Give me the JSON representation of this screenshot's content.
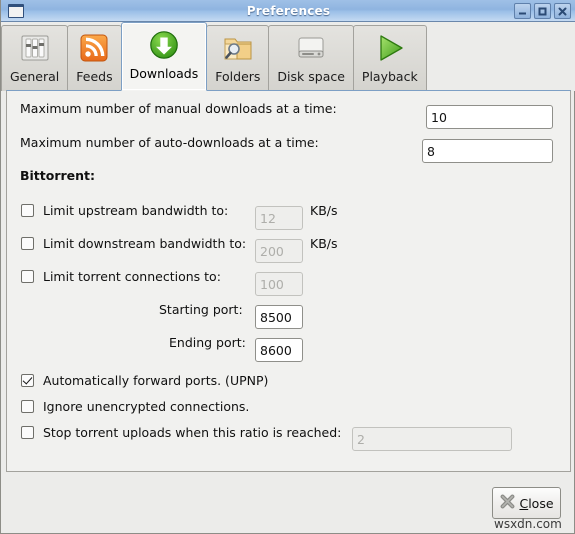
{
  "window": {
    "title": "Preferences",
    "icon": "window-icon",
    "buttons": [
      {
        "name": "minimize-button",
        "glyph": "minimize-icon"
      },
      {
        "name": "maximize-button",
        "glyph": "maximize-icon"
      },
      {
        "name": "close-window-button",
        "glyph": "close-icon"
      }
    ]
  },
  "tabs": [
    {
      "label": "General",
      "icon": "sliders-icon",
      "active": false
    },
    {
      "label": "Feeds",
      "icon": "rss-feed-icon",
      "active": false
    },
    {
      "label": "Downloads",
      "icon": "download-arrow-icon",
      "active": true
    },
    {
      "label": "Folders",
      "icon": "folder-search-icon",
      "active": false
    },
    {
      "label": "Disk space",
      "icon": "hard-disk-icon",
      "active": false
    },
    {
      "label": "Playback",
      "icon": "play-triangle-icon",
      "active": false
    }
  ],
  "downloads": {
    "max_manual_label": "Maximum number of manual downloads at a time:",
    "max_manual_value": "10",
    "max_auto_label": "Maximum number of auto-downloads at a time:",
    "max_auto_value": "8",
    "bittorrent_heading": "Bittorrent:",
    "limit_upstream_label": "Limit upstream bandwidth to:",
    "limit_upstream_value": "12",
    "limit_upstream_unit": "KB/s",
    "limit_upstream_checked": false,
    "limit_downstream_label": "Limit downstream bandwidth to:",
    "limit_downstream_value": "200",
    "limit_downstream_unit": "KB/s",
    "limit_downstream_checked": false,
    "limit_connections_label": "Limit torrent connections to:",
    "limit_connections_value": "100",
    "limit_connections_checked": false,
    "starting_port_label": "Starting port:",
    "starting_port_value": "8500",
    "ending_port_label": "Ending port:",
    "ending_port_value": "8600",
    "upnp_label": "Automatically forward ports.  (UPNP)",
    "upnp_checked": true,
    "ignore_unencrypted_label": "Ignore unencrypted connections.",
    "ignore_unencrypted_checked": false,
    "stop_ratio_label": "Stop torrent uploads when this ratio is reached:",
    "stop_ratio_value": "2",
    "stop_ratio_checked": false
  },
  "footer": {
    "close_prefix": "",
    "close_accel": "C",
    "close_suffix": "lose",
    "close_label": "Close",
    "close_icon": "x-mark-icon",
    "watermark": "wsxdn.com"
  },
  "colors": {
    "titlebar_blue": "#8fb4e0",
    "active_tab_border": "#7d9fc4",
    "panel_bg": "#f1f1ef",
    "window_bg": "#ececea",
    "disabled_text": "#aeaeaa"
  }
}
